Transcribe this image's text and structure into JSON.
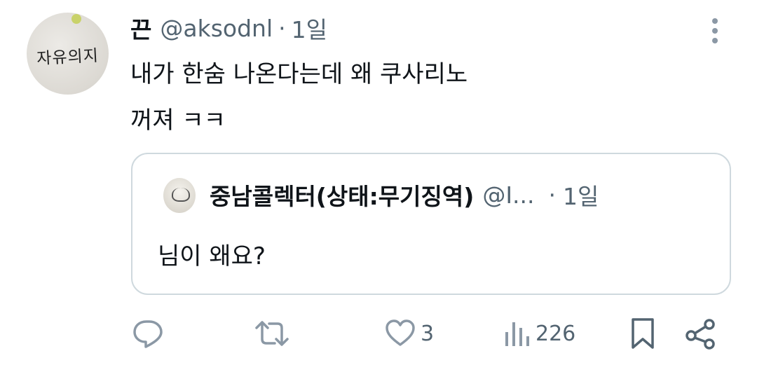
{
  "tweet": {
    "display_name": "끈",
    "handle": "@aksodnl",
    "separator": "·",
    "time": "1일",
    "avatar_text": "자유의지",
    "text_line1": "내가 한숨 나온다는데 왜 쿠사리노",
    "text_line2": "꺼져 ㅋㅋ"
  },
  "quote": {
    "display_name": "중남콜렉터(상태:무기징역)",
    "handle": "@I...",
    "separator": "·",
    "time": "1일",
    "text": "님이 왜요?"
  },
  "actions": {
    "replies": "",
    "retweets": "",
    "likes": "3",
    "views": "226"
  },
  "icons": [
    "more-icon",
    "reply-icon",
    "retweet-icon",
    "like-icon",
    "views-icon",
    "bookmark-icon",
    "share-icon"
  ],
  "colors": {
    "text": "#0f1419",
    "secondary": "#536471",
    "border": "#cfd9de"
  }
}
